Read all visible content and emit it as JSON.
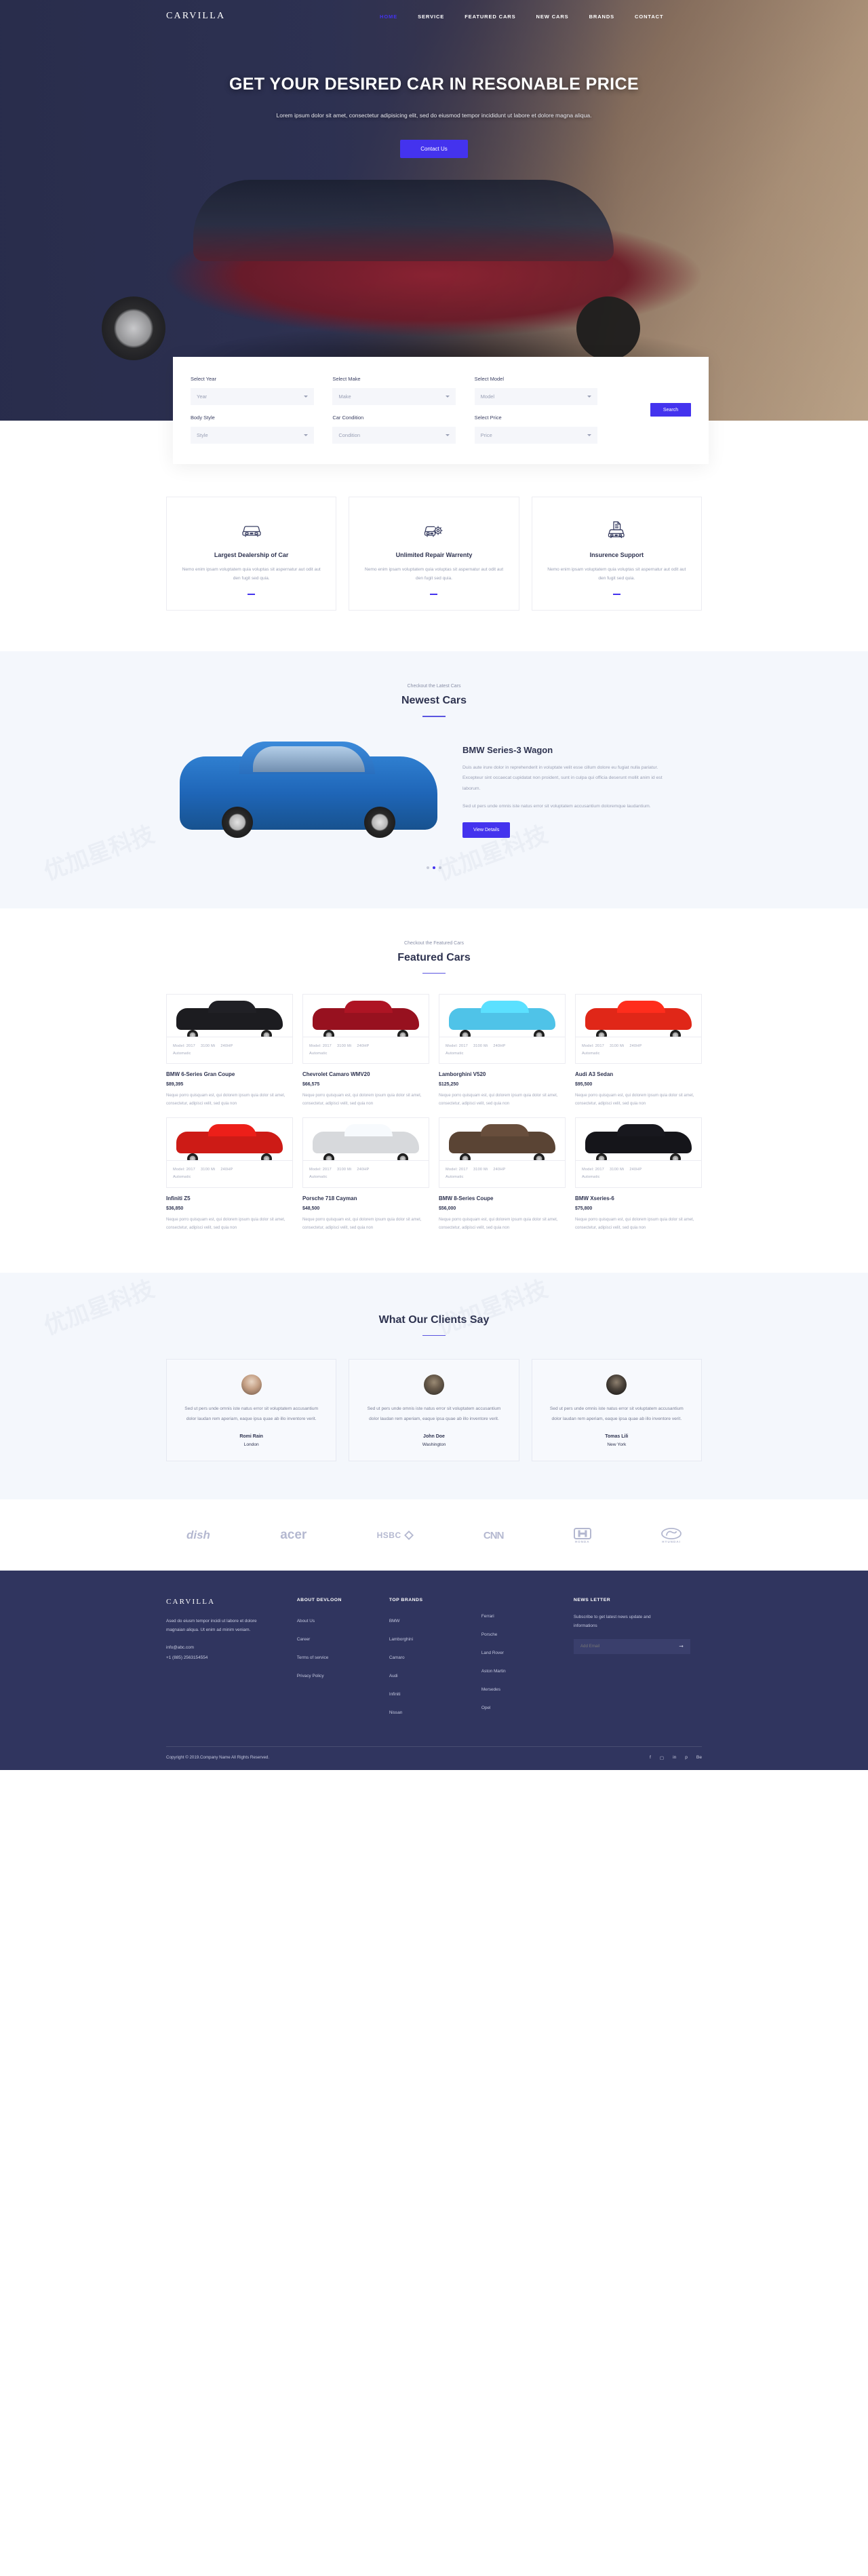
{
  "nav": {
    "brand": "CARVILLA",
    "links": [
      {
        "label": "HOME",
        "active": true
      },
      {
        "label": "SERVICE",
        "active": false
      },
      {
        "label": "FEATURED CARS",
        "active": false
      },
      {
        "label": "NEW CARS",
        "active": false
      },
      {
        "label": "BRANDS",
        "active": false
      },
      {
        "label": "CONTACT",
        "active": false
      }
    ]
  },
  "hero": {
    "title": "GET YOUR DESIRED CAR IN RESONABLE PRICE",
    "subtitle": "Lorem ipsum dolor sit amet, consectetur adipisicing elit, sed do eiusmod tempor incididunt ut labore et dolore magna aliqua.",
    "cta_label": "Contact Us"
  },
  "search": {
    "fields": [
      {
        "label": "Select Year",
        "value": "Year"
      },
      {
        "label": "Select Make",
        "value": "Make"
      },
      {
        "label": "Select Model",
        "value": "Model"
      },
      {
        "label": "Body Style",
        "value": "Style"
      },
      {
        "label": "Car Condition",
        "value": "Condition"
      },
      {
        "label": "Select Price",
        "value": "Price"
      }
    ],
    "button_label": "Search"
  },
  "features": [
    {
      "icon": "car-icon",
      "title": "Largest Dealership of Car",
      "text": "Nemo enim ipsam voluptatem quia voluptas sit aspernatur aut odit aut den fugit sed quia."
    },
    {
      "icon": "car-repair-icon",
      "title": "Unlimited Repair Warrenty",
      "text": "Nemo enim ipsam voluptatem quia voluptas sit aspernatur aut odit aut den fugit sed quia."
    },
    {
      "icon": "car-insurance-icon",
      "title": "Insurence Support",
      "text": "Nemo enim ipsam voluptatem quia voluptas sit aspernatur aut odit aut den fugit sed quia."
    }
  ],
  "newest": {
    "eyebrow": "Checkout the Latest Cars",
    "title": "Newest Cars",
    "car_title": "BMW Series-3 Wagon",
    "paragraph1": "Duis aute irure dolor in reprehenderit in voluptate velit esse cillum dolore eu fugiat nulla pariatur. Excepteur sint occaecat cupidatat non proident, sunt in culpa qui officia deserunt mollit anim id est laborum.",
    "paragraph2": "Sed ut pers unde omnis iste natus error sit voluptatem accusantium doloremque laudantium.",
    "button_label": "View Details",
    "slide_count": 3,
    "active_slide": 2
  },
  "featured": {
    "eyebrow": "Checkout the Featured Cars",
    "title": "Featured Cars",
    "cars": [
      {
        "name": "BMW 6-Series Gran Coupe",
        "price": "$89,395",
        "model": "Model: 2017",
        "mileage": "3100 Mi",
        "power": "240HP",
        "transmission": "Automatic",
        "desc": "Neque porro quisquam est, qui dolorem ipsum quia dolor sit amet, consectetur, adipisci velit, sed quia non",
        "color": "#1c1c20"
      },
      {
        "name": "Chevrolet Camaro WMV20",
        "price": "$66,575",
        "model": "Model: 2017",
        "mileage": "3100 Mi",
        "power": "240HP",
        "transmission": "Automatic",
        "desc": "Neque porro quisquam est, qui dolorem ipsum quia dolor sit amet, consectetur, adipisci velit, sed quia non",
        "color": "#97111f"
      },
      {
        "name": "Lamborghini V520",
        "price": "$125,250",
        "model": "Model: 2017",
        "mileage": "3100 Mi",
        "power": "240HP",
        "transmission": "Automatic",
        "desc": "Neque porro quisquam est, qui dolorem ipsum quia dolor sit amet, consectetur, adipisci velit, sed quia non",
        "color": "#4fc3e8"
      },
      {
        "name": "Audi A3 Sedan",
        "price": "$95,500",
        "model": "Model: 2017",
        "mileage": "3100 Mi",
        "power": "240HP",
        "transmission": "Automatic",
        "desc": "Neque porro quisquam est, qui dolorem ipsum quia dolor sit amet, consectetur, adipisci velit, sed quia non",
        "color": "#e02718"
      },
      {
        "name": "Infiniti Z5",
        "price": "$36,850",
        "model": "Model: 2017",
        "mileage": "3100 Mi",
        "power": "240HP",
        "transmission": "Automatic",
        "desc": "Neque porro quisquam est, qui dolorem ipsum quia dolor sit amet, consectetur, adipisci velit, sed quia non",
        "color": "#cd1b16"
      },
      {
        "name": "Porsche 718 Cayman",
        "price": "$48,500",
        "model": "Model: 2017",
        "mileage": "3100 Mi",
        "power": "240HP",
        "transmission": "Automatic",
        "desc": "Neque porro quisquam est, qui dolorem ipsum quia dolor sit amet, consectetur, adipisci velit, sed quia non",
        "color": "#d7d9dc"
      },
      {
        "name": "BMW 8-Series Coupe",
        "price": "$56,000",
        "model": "Model: 2017",
        "mileage": "3100 Mi",
        "power": "240HP",
        "transmission": "Automatic",
        "desc": "Neque porro quisquam est, qui dolorem ipsum quia dolor sit amet, consectetur, adipisci velit, sed quia non",
        "color": "#5a4434"
      },
      {
        "name": "BMW Xseries-6",
        "price": "$75,800",
        "model": "Model: 2017",
        "mileage": "3100 Mi",
        "power": "240HP",
        "transmission": "Automatic",
        "desc": "Neque porro quisquam est, qui dolorem ipsum quia dolor sit amet, consectetur, adipisci velit, sed quia non",
        "color": "#15151a"
      }
    ]
  },
  "testimonials": {
    "title": "What Our Clients Say",
    "items": [
      {
        "text": "Sed ut pers unde omnis iste natus error sit voluptatem accusantium dolor laudan rem aperiam, eaque ipsa quae ab illo inventore verit.",
        "name": "Romi Rain",
        "city": "London"
      },
      {
        "text": "Sed ut pers unde omnis iste natus error sit voluptatem accusantium dolor laudan rem aperiam, eaque ipsa quae ab illo inventore verit.",
        "name": "John Doe",
        "city": "Washington"
      },
      {
        "text": "Sed ut pers unde omnis iste natus error sit voluptatem accusantium dolor laudan rem aperiam, eaque ipsa quae ab illo inventore verit.",
        "name": "Tomas Lili",
        "city": "New York"
      }
    ]
  },
  "brands": [
    {
      "name": "dish",
      "label": "dish"
    },
    {
      "name": "acer",
      "label": "acer"
    },
    {
      "name": "hsbc",
      "label": "HSBC"
    },
    {
      "name": "cnn",
      "label": "CNN"
    },
    {
      "name": "honda",
      "label": "HONDA"
    },
    {
      "name": "hyundai",
      "label": "HYUNDAI"
    }
  ],
  "footer": {
    "brand": "CARVILLA",
    "about_text": "Ased do eiusm tempor incidi ut labore et dolore magnaian aliqua. Ut enim ad minim veniam.",
    "email": "info@abc.com",
    "phone": "+1 (885) 2563154554",
    "columns": [
      {
        "heading": "ABOUT DEVLOON",
        "items": [
          "About Us",
          "Career",
          "Terms of service",
          "Privacy Policy"
        ]
      },
      {
        "heading": "TOP BRANDS",
        "items": [
          "BMW",
          "Lamborghini",
          "Camaro",
          "Audi",
          "Infiniti",
          "Nissan"
        ]
      },
      {
        "heading": "",
        "items": [
          "Ferrari",
          "Porsche",
          "Land Rover",
          "Aston Martin",
          "Mersedes",
          "Opel"
        ]
      }
    ],
    "newsletter": {
      "heading": "NEWS LETTER",
      "text": "Subscribe to get latest news update and informations",
      "placeholder": "Add Email",
      "submit_icon": "arrow-right-icon"
    },
    "copyright": "Copyright © 2019.Company Name All Rights Reserved.",
    "socials": [
      "facebook-icon",
      "instagram-icon",
      "linkedin-icon",
      "pinterest-icon",
      "behance-icon"
    ]
  },
  "colors": {
    "accent": "#4433ee",
    "footer_bg": "#30355f",
    "light_bg": "#f4f7fc",
    "text": "#2e3350",
    "muted": "#9aa0b5"
  }
}
